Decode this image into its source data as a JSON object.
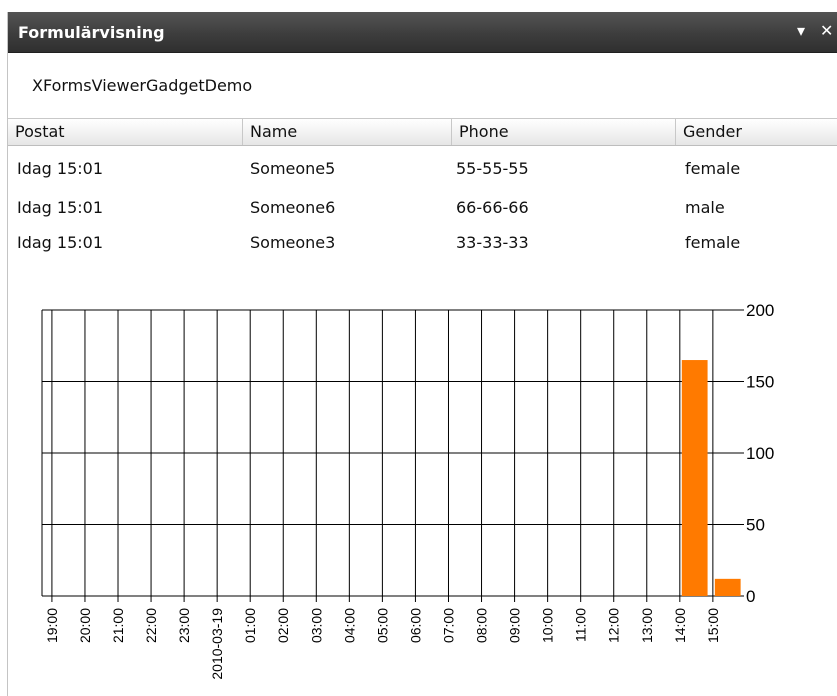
{
  "window": {
    "title": "Formulärvisning",
    "dropdown_glyph": "▾",
    "close_glyph": "✕"
  },
  "form_name": "XFormsViewerGadgetDemo",
  "table": {
    "columns": [
      "Postat",
      "Name",
      "Phone",
      "Gender"
    ],
    "rows": [
      [
        "Idag 15:01",
        "Someone5",
        "55-55-55",
        "female"
      ],
      [
        "Idag 15:01",
        "Someone6",
        "66-66-66",
        "male"
      ],
      [
        "Idag 15:01",
        "Someone3",
        "33-33-33",
        "female"
      ]
    ]
  },
  "colors": {
    "bar": "#ff7a00",
    "grid": "#000000"
  },
  "chart_data": {
    "type": "bar",
    "categories": [
      "19:00",
      "20:00",
      "21:00",
      "22:00",
      "23:00",
      "2010-03-19",
      "01:00",
      "02:00",
      "03:00",
      "04:00",
      "05:00",
      "06:00",
      "07:00",
      "08:00",
      "09:00",
      "10:00",
      "11:00",
      "12:00",
      "13:00",
      "14:00",
      "15:00"
    ],
    "values": [
      0,
      0,
      0,
      0,
      0,
      0,
      0,
      0,
      0,
      0,
      0,
      0,
      0,
      0,
      0,
      0,
      0,
      0,
      0,
      165,
      12
    ],
    "ylim": [
      0,
      200
    ],
    "y_ticks": [
      0,
      50,
      100,
      150,
      200
    ],
    "y_tick_labels": [
      "0",
      "50",
      "100",
      "150",
      "200"
    ],
    "y_axis_side": "right",
    "grid": true,
    "legend": false
  }
}
